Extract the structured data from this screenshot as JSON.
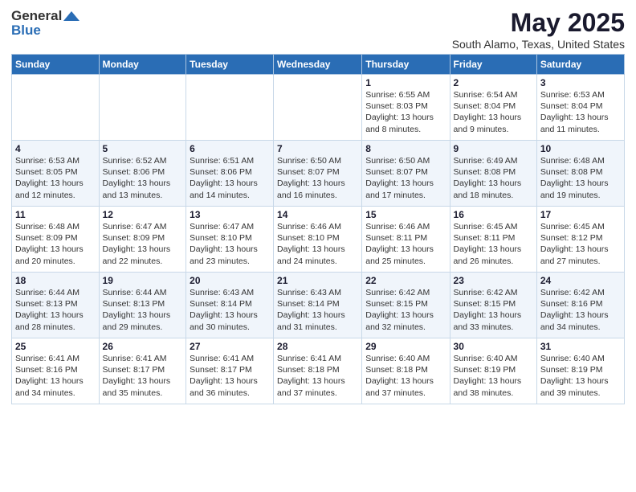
{
  "header": {
    "logo_general": "General",
    "logo_blue": "Blue",
    "title": "May 2025",
    "subtitle": "South Alamo, Texas, United States"
  },
  "calendar": {
    "days_of_week": [
      "Sunday",
      "Monday",
      "Tuesday",
      "Wednesday",
      "Thursday",
      "Friday",
      "Saturday"
    ],
    "weeks": [
      [
        {
          "day": "",
          "info": ""
        },
        {
          "day": "",
          "info": ""
        },
        {
          "day": "",
          "info": ""
        },
        {
          "day": "",
          "info": ""
        },
        {
          "day": "1",
          "info": "Sunrise: 6:55 AM\nSunset: 8:03 PM\nDaylight: 13 hours and 8 minutes."
        },
        {
          "day": "2",
          "info": "Sunrise: 6:54 AM\nSunset: 8:04 PM\nDaylight: 13 hours and 9 minutes."
        },
        {
          "day": "3",
          "info": "Sunrise: 6:53 AM\nSunset: 8:04 PM\nDaylight: 13 hours and 11 minutes."
        }
      ],
      [
        {
          "day": "4",
          "info": "Sunrise: 6:53 AM\nSunset: 8:05 PM\nDaylight: 13 hours and 12 minutes."
        },
        {
          "day": "5",
          "info": "Sunrise: 6:52 AM\nSunset: 8:06 PM\nDaylight: 13 hours and 13 minutes."
        },
        {
          "day": "6",
          "info": "Sunrise: 6:51 AM\nSunset: 8:06 PM\nDaylight: 13 hours and 14 minutes."
        },
        {
          "day": "7",
          "info": "Sunrise: 6:50 AM\nSunset: 8:07 PM\nDaylight: 13 hours and 16 minutes."
        },
        {
          "day": "8",
          "info": "Sunrise: 6:50 AM\nSunset: 8:07 PM\nDaylight: 13 hours and 17 minutes."
        },
        {
          "day": "9",
          "info": "Sunrise: 6:49 AM\nSunset: 8:08 PM\nDaylight: 13 hours and 18 minutes."
        },
        {
          "day": "10",
          "info": "Sunrise: 6:48 AM\nSunset: 8:08 PM\nDaylight: 13 hours and 19 minutes."
        }
      ],
      [
        {
          "day": "11",
          "info": "Sunrise: 6:48 AM\nSunset: 8:09 PM\nDaylight: 13 hours and 20 minutes."
        },
        {
          "day": "12",
          "info": "Sunrise: 6:47 AM\nSunset: 8:09 PM\nDaylight: 13 hours and 22 minutes."
        },
        {
          "day": "13",
          "info": "Sunrise: 6:47 AM\nSunset: 8:10 PM\nDaylight: 13 hours and 23 minutes."
        },
        {
          "day": "14",
          "info": "Sunrise: 6:46 AM\nSunset: 8:10 PM\nDaylight: 13 hours and 24 minutes."
        },
        {
          "day": "15",
          "info": "Sunrise: 6:46 AM\nSunset: 8:11 PM\nDaylight: 13 hours and 25 minutes."
        },
        {
          "day": "16",
          "info": "Sunrise: 6:45 AM\nSunset: 8:11 PM\nDaylight: 13 hours and 26 minutes."
        },
        {
          "day": "17",
          "info": "Sunrise: 6:45 AM\nSunset: 8:12 PM\nDaylight: 13 hours and 27 minutes."
        }
      ],
      [
        {
          "day": "18",
          "info": "Sunrise: 6:44 AM\nSunset: 8:13 PM\nDaylight: 13 hours and 28 minutes."
        },
        {
          "day": "19",
          "info": "Sunrise: 6:44 AM\nSunset: 8:13 PM\nDaylight: 13 hours and 29 minutes."
        },
        {
          "day": "20",
          "info": "Sunrise: 6:43 AM\nSunset: 8:14 PM\nDaylight: 13 hours and 30 minutes."
        },
        {
          "day": "21",
          "info": "Sunrise: 6:43 AM\nSunset: 8:14 PM\nDaylight: 13 hours and 31 minutes."
        },
        {
          "day": "22",
          "info": "Sunrise: 6:42 AM\nSunset: 8:15 PM\nDaylight: 13 hours and 32 minutes."
        },
        {
          "day": "23",
          "info": "Sunrise: 6:42 AM\nSunset: 8:15 PM\nDaylight: 13 hours and 33 minutes."
        },
        {
          "day": "24",
          "info": "Sunrise: 6:42 AM\nSunset: 8:16 PM\nDaylight: 13 hours and 34 minutes."
        }
      ],
      [
        {
          "day": "25",
          "info": "Sunrise: 6:41 AM\nSunset: 8:16 PM\nDaylight: 13 hours and 34 minutes."
        },
        {
          "day": "26",
          "info": "Sunrise: 6:41 AM\nSunset: 8:17 PM\nDaylight: 13 hours and 35 minutes."
        },
        {
          "day": "27",
          "info": "Sunrise: 6:41 AM\nSunset: 8:17 PM\nDaylight: 13 hours and 36 minutes."
        },
        {
          "day": "28",
          "info": "Sunrise: 6:41 AM\nSunset: 8:18 PM\nDaylight: 13 hours and 37 minutes."
        },
        {
          "day": "29",
          "info": "Sunrise: 6:40 AM\nSunset: 8:18 PM\nDaylight: 13 hours and 37 minutes."
        },
        {
          "day": "30",
          "info": "Sunrise: 6:40 AM\nSunset: 8:19 PM\nDaylight: 13 hours and 38 minutes."
        },
        {
          "day": "31",
          "info": "Sunrise: 6:40 AM\nSunset: 8:19 PM\nDaylight: 13 hours and 39 minutes."
        }
      ]
    ]
  }
}
